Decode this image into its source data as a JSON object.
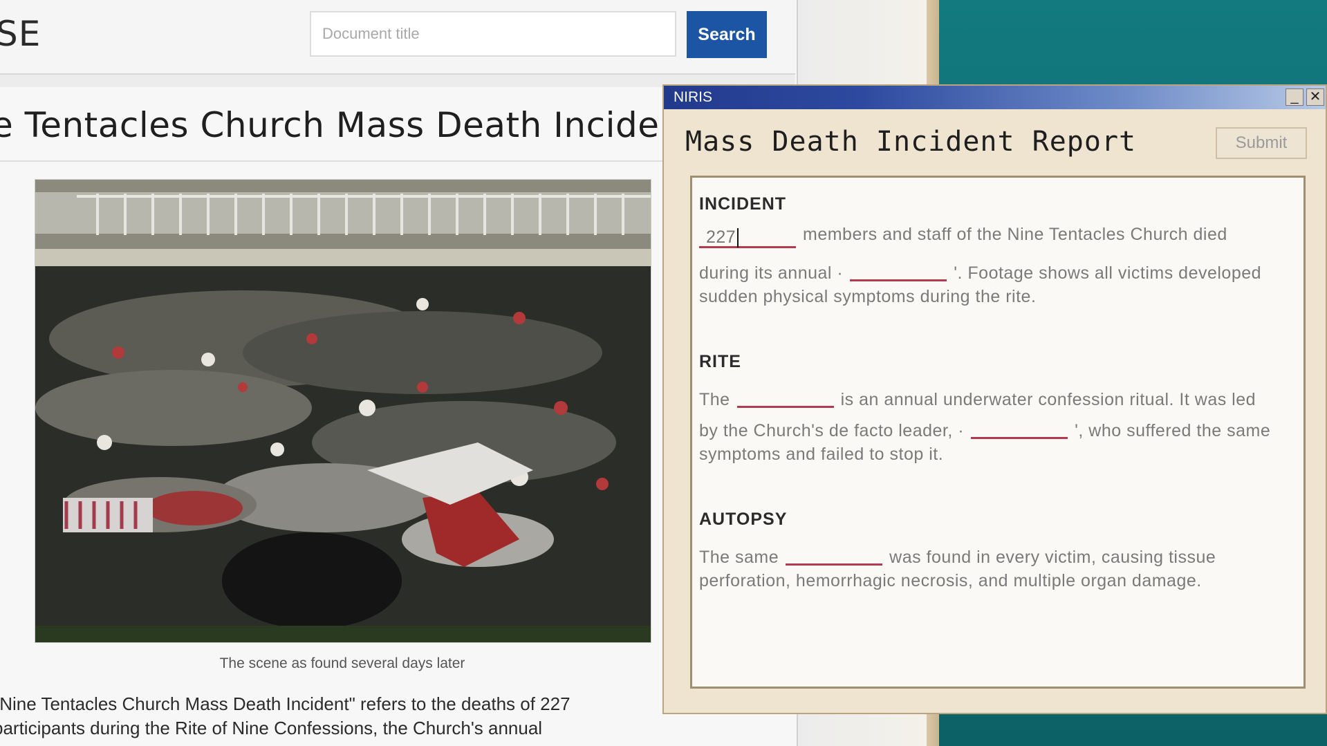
{
  "site": {
    "logo": "SE",
    "search": {
      "placeholder": "Document title",
      "button_label": "Search"
    }
  },
  "article": {
    "title": "e Tentacles Church Mass Death Incident",
    "photo_caption": "The scene as found several days later",
    "body_lines": [
      "\"Nine Tentacles Church Mass Death Incident\" refers to the deaths of 227",
      "participants during the Rite of Nine Confessions, the Church's annual"
    ]
  },
  "niris": {
    "window_title": "NIRIS",
    "minimize": "_",
    "close": "✕",
    "report_title": "Mass Death Incident Report",
    "submit_label": "Submit",
    "sections": {
      "incident": {
        "heading": "INCIDENT",
        "blank_value": "227",
        "line1_after": "members and staff of the Nine Tentacles Church died",
        "line2_before": "during its annual ·",
        "line2_after": "'. Footage shows all victims developed",
        "line3": "sudden physical symptoms during the rite."
      },
      "rite": {
        "heading": "RITE",
        "line1_before": "The",
        "line1_after": "is an annual underwater confession ritual. It was led",
        "line2_before": "by the Church's de facto leader, ·",
        "line2_after": "', who suffered the same",
        "line3": "symptoms and failed to stop it."
      },
      "autopsy": {
        "heading": "AUTOPSY",
        "line1_before": "The same",
        "line1_after": "was found in every victim, causing tissue",
        "line2": "perforation, hemorrhagic necrosis, and multiple organ damage."
      }
    }
  }
}
